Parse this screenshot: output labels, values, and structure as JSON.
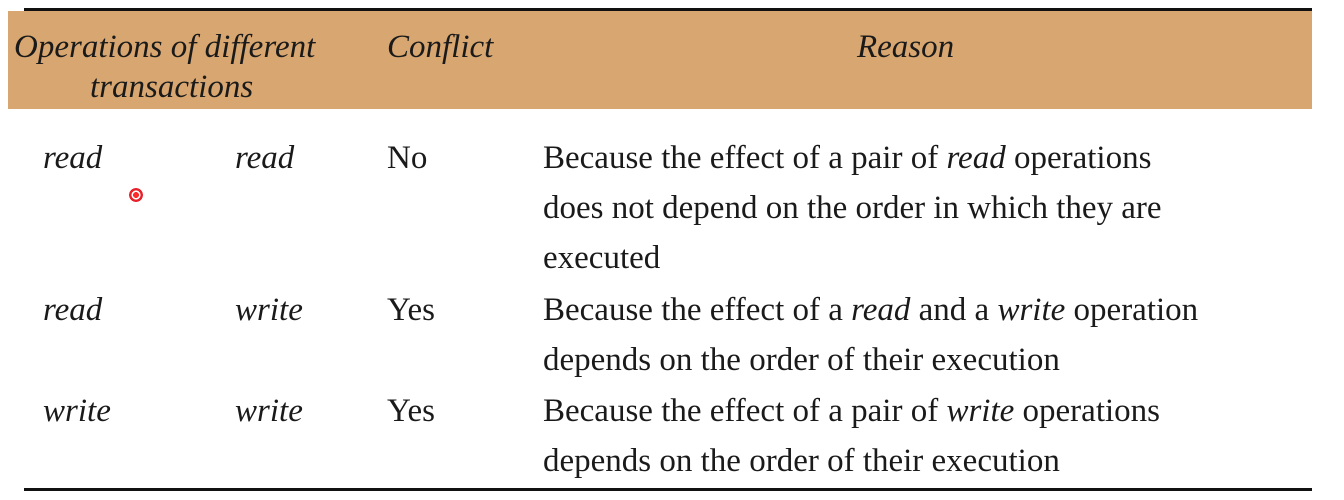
{
  "table": {
    "header": {
      "operations_line1": "Operations of different",
      "operations_line2": "transactions",
      "conflict": "Conflict",
      "reason": "Reason"
    },
    "rows": [
      {
        "op1": "read",
        "op2": "read",
        "conflict": "No",
        "reason": {
          "l1_pre": "Because the effect of a pair of ",
          "l1_em": "read",
          "l1_post": " operations",
          "l2": "does not depend on the order in which they are",
          "l3": "executed"
        }
      },
      {
        "op1": "read",
        "op2": "write",
        "conflict": "Yes",
        "reason": {
          "l1_pre": "Because the effect of a ",
          "l1_em": "read",
          "l1_mid": " and a ",
          "l1_em2": "write",
          "l1_post": " operation",
          "l2": "depends on the order of their execution"
        }
      },
      {
        "op1": "write",
        "op2": "write",
        "conflict": "Yes",
        "reason": {
          "l1_pre": "Because the effect of a pair of ",
          "l1_em": "write",
          "l1_post": " operations",
          "l2": "depends on the order of their execution"
        }
      }
    ]
  },
  "colors": {
    "header_band": "#d8a670",
    "rule": "#111111",
    "cursor": "#e8202a"
  },
  "icons": {
    "cursor": "pointer-dot-icon"
  }
}
